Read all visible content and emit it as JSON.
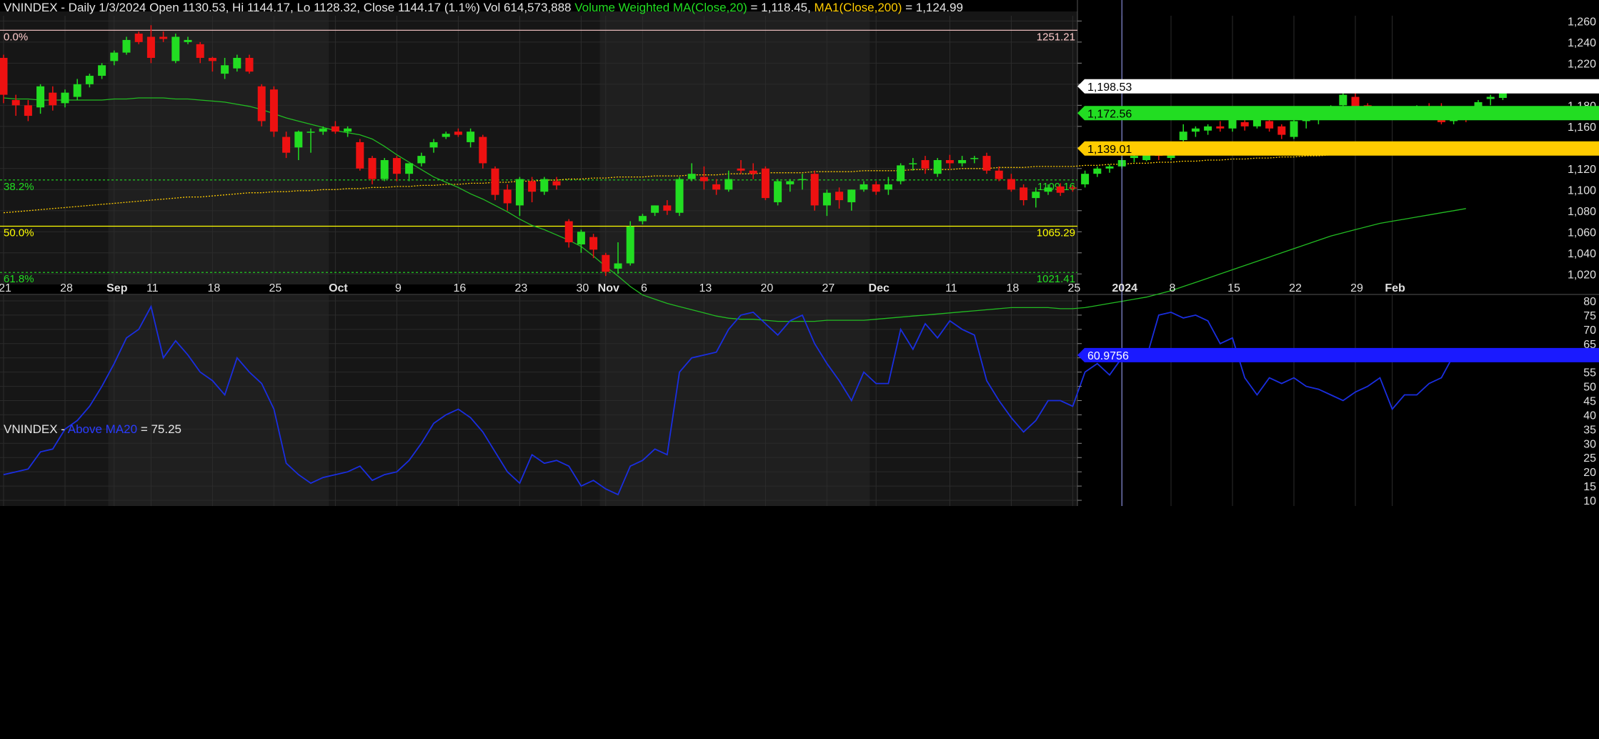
{
  "header": {
    "symbol": "VNINDEX",
    "info": " - Daily 1/3/2024 Open 1130.53, Hi 1144.17, Lo 1128.32, Close 1144.17 (1.1%) Vol 614,573,888 ",
    "ma20_label": "Volume Weighted MA(Close,20)",
    "ma20_value": " = 1,118.45, ",
    "ma200_label": "MA1(Close,200)",
    "ma200_value": " = 1,124.99"
  },
  "lower_header": {
    "symbol": "VNINDEX",
    "sep": " - ",
    "indicator": "Above MA20",
    "value": " = 75.25"
  },
  "colors": {
    "bg": "#000000",
    "up": "#22dd22",
    "down": "#ee1111",
    "ma20": "#22bb22",
    "ma200": "#ffcc00",
    "breadth": "#1a2ee0",
    "fib0": "#ffcccc",
    "fib382": "#22dd22",
    "fib50": "#ffff00",
    "fib618": "#22dd22",
    "last_price_box": "#ffffff",
    "ma20_box": "#22dd22",
    "ma200_box": "#ffcc00",
    "breadth_box": "#1a1aff"
  },
  "fib_levels": [
    {
      "label": "0.0%",
      "value_label": "1251.21",
      "value": 1251.21
    },
    {
      "label": "38.2%",
      "value_label": "1109.16",
      "value": 1109.16
    },
    {
      "label": "50.0%",
      "value_label": "1065.29",
      "value": 1065.29
    },
    {
      "label": "61.8%",
      "value_label": "1021.41",
      "value": 1021.41
    }
  ],
  "price_tags": {
    "last": "1,198.53",
    "ma20": "1,172.56",
    "ma200": "1,139.01"
  },
  "breadth_tag": "60.9756",
  "x_axis": {
    "labels": [
      {
        "text": "21",
        "idx": 0
      },
      {
        "text": "28",
        "idx": 5
      },
      {
        "text": "Sep",
        "idx": 9,
        "bold": true
      },
      {
        "text": "11",
        "idx": 12
      },
      {
        "text": "18",
        "idx": 17
      },
      {
        "text": "25",
        "idx": 22
      },
      {
        "text": "Oct",
        "idx": 27,
        "bold": true
      },
      {
        "text": "9",
        "idx": 32
      },
      {
        "text": "16",
        "idx": 37
      },
      {
        "text": "23",
        "idx": 42
      },
      {
        "text": "30",
        "idx": 47
      },
      {
        "text": "Nov",
        "idx": 49,
        "bold": true
      },
      {
        "text": "6",
        "idx": 52
      },
      {
        "text": "13",
        "idx": 57
      },
      {
        "text": "20",
        "idx": 62
      },
      {
        "text": "27",
        "idx": 67
      },
      {
        "text": "Dec",
        "idx": 71,
        "bold": true
      },
      {
        "text": "11",
        "idx": 77
      },
      {
        "text": "18",
        "idx": 82
      },
      {
        "text": "25",
        "idx": 87
      },
      {
        "text": "2024",
        "idx": 91,
        "bold": true
      },
      {
        "text": "8",
        "idx": 95
      },
      {
        "text": "15",
        "idx": 100
      },
      {
        "text": "22",
        "idx": 105
      },
      {
        "text": "29",
        "idx": 110
      },
      {
        "text": "Feb",
        "idx": 113,
        "bold": true
      }
    ]
  },
  "cursor_idx": 91,
  "chart_data": [
    {
      "type": "candlestick",
      "title": "VNINDEX - Daily",
      "ylim": [
        1010,
        1265
      ],
      "y_ticks": [
        1020,
        1040,
        1060,
        1080,
        1100,
        1120,
        1140,
        1160,
        1180,
        1200,
        1220,
        1240,
        1260
      ],
      "ohlc": [
        [
          1225,
          1228,
          1182,
          1190
        ],
        [
          1185,
          1190,
          1170,
          1180
        ],
        [
          1180,
          1185,
          1165,
          1170
        ],
        [
          1178,
          1200,
          1172,
          1198
        ],
        [
          1192,
          1198,
          1175,
          1180
        ],
        [
          1182,
          1195,
          1178,
          1192
        ],
        [
          1188,
          1205,
          1185,
          1200
        ],
        [
          1200,
          1210,
          1197,
          1208
        ],
        [
          1208,
          1220,
          1205,
          1218
        ],
        [
          1222,
          1232,
          1218,
          1230
        ],
        [
          1230,
          1245,
          1228,
          1242
        ],
        [
          1248,
          1250,
          1238,
          1240
        ],
        [
          1245,
          1256,
          1220,
          1225
        ],
        [
          1245,
          1250,
          1240,
          1243
        ],
        [
          1222,
          1248,
          1220,
          1245
        ],
        [
          1240,
          1245,
          1238,
          1242
        ],
        [
          1238,
          1240,
          1220,
          1225
        ],
        [
          1225,
          1226,
          1212,
          1222
        ],
        [
          1210,
          1225,
          1205,
          1218
        ],
        [
          1215,
          1228,
          1212,
          1225
        ],
        [
          1225,
          1228,
          1210,
          1212
        ],
        [
          1198,
          1200,
          1160,
          1165
        ],
        [
          1195,
          1198,
          1150,
          1155
        ],
        [
          1150,
          1155,
          1130,
          1135
        ],
        [
          1140,
          1156,
          1128,
          1155
        ],
        [
          1155,
          1158,
          1135,
          1155
        ],
        [
          1155,
          1160,
          1152,
          1158
        ],
        [
          1160,
          1165,
          1153,
          1155
        ],
        [
          1155,
          1160,
          1150,
          1158
        ],
        [
          1145,
          1148,
          1118,
          1120
        ],
        [
          1130,
          1132,
          1105,
          1110
        ],
        [
          1110,
          1130,
          1108,
          1128
        ],
        [
          1130,
          1132,
          1108,
          1115
        ],
        [
          1115,
          1125,
          1108,
          1125
        ],
        [
          1125,
          1135,
          1122,
          1132
        ],
        [
          1140,
          1148,
          1135,
          1145
        ],
        [
          1150,
          1155,
          1148,
          1153
        ],
        [
          1155,
          1158,
          1150,
          1152
        ],
        [
          1145,
          1158,
          1140,
          1155
        ],
        [
          1150,
          1152,
          1120,
          1125
        ],
        [
          1120,
          1122,
          1090,
          1095
        ],
        [
          1100,
          1105,
          1080,
          1087
        ],
        [
          1085,
          1112,
          1075,
          1110
        ],
        [
          1108,
          1112,
          1088,
          1098
        ],
        [
          1098,
          1112,
          1095,
          1110
        ],
        [
          1108,
          1112,
          1100,
          1104
        ],
        [
          1070,
          1072,
          1045,
          1050
        ],
        [
          1048,
          1062,
          1040,
          1060
        ],
        [
          1055,
          1058,
          1035,
          1043
        ],
        [
          1038,
          1040,
          1018,
          1022
        ],
        [
          1025,
          1050,
          1020,
          1030
        ],
        [
          1030,
          1070,
          1028,
          1065
        ],
        [
          1070,
          1077,
          1067,
          1075
        ],
        [
          1078,
          1085,
          1075,
          1085
        ],
        [
          1085,
          1090,
          1076,
          1080
        ],
        [
          1078,
          1112,
          1075,
          1110
        ],
        [
          1110,
          1125,
          1108,
          1115
        ],
        [
          1112,
          1122,
          1100,
          1108
        ],
        [
          1105,
          1110,
          1095,
          1100
        ],
        [
          1100,
          1118,
          1098,
          1110
        ],
        [
          1120,
          1128,
          1115,
          1118
        ],
        [
          1118,
          1125,
          1110,
          1115
        ],
        [
          1120,
          1122,
          1090,
          1092
        ],
        [
          1088,
          1110,
          1085,
          1108
        ],
        [
          1105,
          1110,
          1098,
          1108
        ],
        [
          1110,
          1115,
          1100,
          1110
        ],
        [
          1115,
          1118,
          1080,
          1085
        ],
        [
          1085,
          1100,
          1075,
          1097
        ],
        [
          1098,
          1102,
          1082,
          1090
        ],
        [
          1088,
          1100,
          1080,
          1100
        ],
        [
          1100,
          1108,
          1098,
          1105
        ],
        [
          1105,
          1108,
          1095,
          1098
        ],
        [
          1100,
          1112,
          1095,
          1105
        ],
        [
          1108,
          1125,
          1105,
          1123
        ],
        [
          1125,
          1130,
          1118,
          1125
        ],
        [
          1128,
          1132,
          1115,
          1120
        ],
        [
          1115,
          1130,
          1112,
          1128
        ],
        [
          1128,
          1133,
          1120,
          1125
        ],
        [
          1125,
          1132,
          1122,
          1128
        ],
        [
          1130,
          1132,
          1125,
          1130
        ],
        [
          1132,
          1135,
          1115,
          1118
        ],
        [
          1118,
          1122,
          1108,
          1110
        ],
        [
          1110,
          1115,
          1098,
          1100
        ],
        [
          1102,
          1105,
          1085,
          1090
        ],
        [
          1092,
          1102,
          1083,
          1098
        ],
        [
          1098,
          1105,
          1095,
          1102
        ],
        [
          1103,
          1106,
          1094,
          1097
        ],
        [
          1102,
          1104,
          1098,
          1101
        ],
        [
          1105,
          1118,
          1102,
          1115
        ],
        [
          1115,
          1122,
          1112,
          1120
        ],
        [
          1120,
          1124,
          1116,
          1122
        ],
        [
          1122,
          1130,
          1120,
          1128
        ],
        [
          1130,
          1134,
          1126,
          1132
        ],
        [
          1128,
          1138,
          1127,
          1136
        ],
        [
          1140,
          1144,
          1128,
          1132
        ],
        [
          1130,
          1145,
          1128,
          1144
        ],
        [
          1147,
          1162,
          1145,
          1155
        ],
        [
          1155,
          1160,
          1150,
          1158
        ],
        [
          1156,
          1162,
          1152,
          1160
        ],
        [
          1160,
          1165,
          1155,
          1158
        ],
        [
          1158,
          1170,
          1155,
          1167
        ],
        [
          1164,
          1166,
          1156,
          1160
        ],
        [
          1160,
          1172,
          1158,
          1168
        ],
        [
          1165,
          1168,
          1155,
          1158
        ],
        [
          1160,
          1162,
          1148,
          1152
        ],
        [
          1150,
          1168,
          1148,
          1165
        ],
        [
          1165,
          1168,
          1158,
          1166
        ],
        [
          1168,
          1175,
          1162,
          1172
        ],
        [
          1172,
          1180,
          1170,
          1178
        ],
        [
          1180,
          1192,
          1178,
          1190
        ],
        [
          1188,
          1192,
          1172,
          1177
        ],
        [
          1180,
          1182,
          1170,
          1172
        ],
        [
          1175,
          1177,
          1168,
          1170
        ],
        [
          1170,
          1175,
          1168,
          1172
        ],
        [
          1172,
          1178,
          1168,
          1175
        ],
        [
          1175,
          1180,
          1170,
          1178
        ],
        [
          1178,
          1182,
          1172,
          1175
        ],
        [
          1178,
          1182,
          1162,
          1164
        ],
        [
          1165,
          1170,
          1162,
          1170
        ],
        [
          1172,
          1175,
          1164,
          1167
        ],
        [
          1170,
          1185,
          1168,
          1183
        ],
        [
          1186,
          1190,
          1180,
          1188
        ],
        [
          1187,
          1200,
          1185,
          1198
        ]
      ],
      "ma20": [
        1187,
        1186,
        1186,
        1185,
        1185,
        1185,
        1185,
        1185,
        1185,
        1186,
        1186,
        1187,
        1187,
        1187,
        1186,
        1186,
        1185,
        1184,
        1183,
        1181,
        1179,
        1176,
        1172,
        1168,
        1165,
        1162,
        1159,
        1156,
        1154,
        1152,
        1148,
        1141,
        1133,
        1126,
        1119,
        1112,
        1107,
        1102,
        1096,
        1091,
        1085,
        1079,
        1072,
        1066,
        1062,
        1057,
        1052,
        1046,
        1037,
        1027,
        1018,
        1008,
        1000,
        996,
        992,
        989,
        986,
        983,
        980,
        978,
        977,
        977,
        976,
        975,
        975,
        975,
        975,
        976,
        976,
        976,
        976,
        977,
        978,
        979,
        980,
        981,
        982,
        983,
        984,
        985,
        986,
        987,
        988,
        988,
        988,
        988,
        987,
        987,
        988,
        990,
        992,
        994,
        996,
        998,
        1001,
        1004,
        1008,
        1012,
        1016,
        1020,
        1024,
        1028,
        1032,
        1036,
        1040,
        1044,
        1048,
        1052,
        1056,
        1059,
        1062,
        1065,
        1068,
        1070,
        1072,
        1074,
        1076,
        1078,
        1080,
        1082
      ],
      "ma200": [
        1078,
        1079,
        1080,
        1081,
        1082,
        1083,
        1084,
        1085,
        1086,
        1087,
        1088,
        1089,
        1090,
        1091,
        1092,
        1093,
        1093,
        1094,
        1095,
        1096,
        1097,
        1097,
        1098,
        1098,
        1099,
        1099,
        1100,
        1100,
        1101,
        1101,
        1102,
        1102,
        1103,
        1103,
        1104,
        1104,
        1105,
        1105,
        1106,
        1106,
        1107,
        1107,
        1108,
        1108,
        1109,
        1109,
        1110,
        1110,
        1111,
        1111,
        1112,
        1112,
        1112,
        1113,
        1113,
        1113,
        1114,
        1114,
        1114,
        1115,
        1115,
        1115,
        1116,
        1116,
        1116,
        1116,
        1117,
        1117,
        1117,
        1117,
        1118,
        1118,
        1118,
        1118,
        1119,
        1119,
        1119,
        1119,
        1120,
        1120,
        1120,
        1121,
        1121,
        1121,
        1122,
        1122,
        1122,
        1122,
        1123,
        1123,
        1124,
        1124,
        1125,
        1125,
        1126,
        1126,
        1127,
        1127,
        1128,
        1128,
        1129,
        1129,
        1130,
        1130,
        1131,
        1131,
        1132,
        1132,
        1133,
        1133,
        1134,
        1134,
        1135,
        1135,
        1136,
        1136,
        1137,
        1137,
        1138,
        1139
      ]
    },
    {
      "type": "line",
      "title": "Above MA20",
      "ylim": [
        8,
        82
      ],
      "y_ticks": [
        10,
        15,
        20,
        25,
        30,
        35,
        40,
        45,
        50,
        55,
        60,
        65,
        70,
        75,
        80
      ],
      "series": [
        {
          "name": "Above MA20",
          "values": [
            19,
            20,
            21,
            27,
            28,
            35,
            38,
            43,
            50,
            58,
            67,
            70,
            78,
            60,
            66,
            61,
            55,
            52,
            47,
            60,
            55,
            51,
            42,
            23,
            19,
            16,
            18,
            19,
            20,
            22,
            17,
            19,
            20,
            24,
            30,
            37,
            40,
            42,
            39,
            34,
            27,
            20,
            16,
            26,
            23,
            24,
            22,
            15,
            17,
            14,
            12,
            22,
            24,
            28,
            26,
            55,
            60,
            61,
            62,
            70,
            75,
            76,
            72,
            68,
            73,
            75,
            65,
            58,
            52,
            45,
            55,
            51,
            51,
            70,
            63,
            72,
            67,
            73,
            70,
            68,
            52,
            45,
            39,
            34,
            38,
            45,
            45,
            43,
            55,
            58,
            54,
            60,
            63,
            60,
            75,
            76,
            74,
            75,
            73,
            65,
            67,
            53,
            47,
            53,
            51,
            53,
            50,
            49,
            47,
            45,
            48,
            50,
            53,
            42,
            47,
            47,
            51,
            53,
            61
          ]
        }
      ]
    }
  ]
}
